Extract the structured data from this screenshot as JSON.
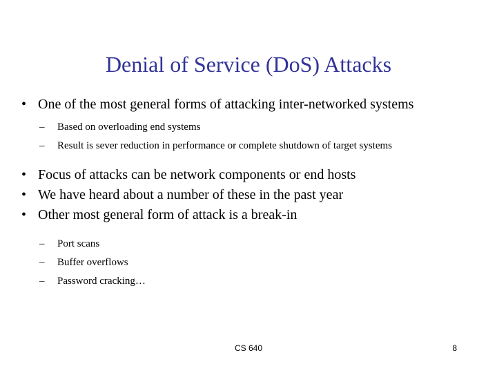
{
  "slide": {
    "title": "Denial of Service (DoS) Attacks",
    "title_color": "#333399",
    "background_color": "#ffffff",
    "text_color": "#000000",
    "level1_marker": "•",
    "level2_marker": "–",
    "content": [
      {
        "level": 1,
        "text": "One of the most general forms of attacking inter-networked systems"
      },
      {
        "level": 2,
        "text": "Based on overloading end systems"
      },
      {
        "level": 2,
        "text": "Result is sever reduction in performance or complete shutdown of target systems"
      },
      {
        "level": 1,
        "text": "Focus of attacks can be network components or end hosts"
      },
      {
        "level": 1,
        "text": "We have heard about a number of these in the past year"
      },
      {
        "level": 1,
        "text": "Other most general form of attack is a break-in"
      },
      {
        "level": 2,
        "text": "Port scans"
      },
      {
        "level": 2,
        "text": "Buffer overflows"
      },
      {
        "level": 2,
        "text": "Password cracking…"
      }
    ]
  },
  "footer": {
    "course": "CS 640",
    "page_number": "8"
  }
}
